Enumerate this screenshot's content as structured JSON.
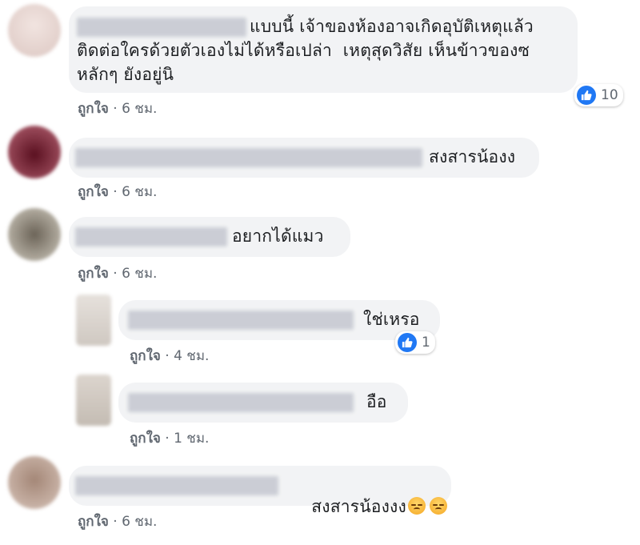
{
  "comments": [
    {
      "text_lines": [
        "แบบนี้ เจ้าของห้องอาจเกิดอุบัติเหตุแล้ว",
        "ติดต่อใครด้วยตัวเองไม่ได้หรือเปล่า  เหตุสุดวิสัย เห็นข้าวของซ",
        "หลักๆ ยังอยู่นิ"
      ],
      "like_label": "ถูกใจ",
      "time": "6 ชม.",
      "reaction_count": "10",
      "avatar_color": "#e6d3cf"
    },
    {
      "text_lines": [
        "สงสารน้องง"
      ],
      "like_label": "ถูกใจ",
      "time": "6 ชม.",
      "avatar_color": "#7a2433"
    },
    {
      "text_lines": [
        "อยากได้แมว"
      ],
      "like_label": "ถูกใจ",
      "time": "6 ชม.",
      "avatar_color": "#9b9488"
    },
    {
      "text_lines": [
        "ใช่เหรอ"
      ],
      "like_label": "ถูกใจ",
      "time": "4 ชม.",
      "reaction_count": "1",
      "avatar_color": "#d8d2cc"
    },
    {
      "text_lines": [
        "อือ"
      ],
      "like_label": "ถูกใจ",
      "time": "1 ชม.",
      "avatar_color": "#cfc8c0"
    },
    {
      "text_lines": [
        "สงสารน้องงง"
      ],
      "like_label": "ถูกใจ",
      "time": "6 ชม.",
      "emojis": [
        "weary-face-emoji",
        "weary-face-emoji"
      ],
      "avatar_color": "#b79c8e"
    }
  ],
  "separator": "·",
  "colors": {
    "bubble": "#f2f3f5",
    "like_blue": "#2078f4",
    "meta_gray": "#606770"
  }
}
